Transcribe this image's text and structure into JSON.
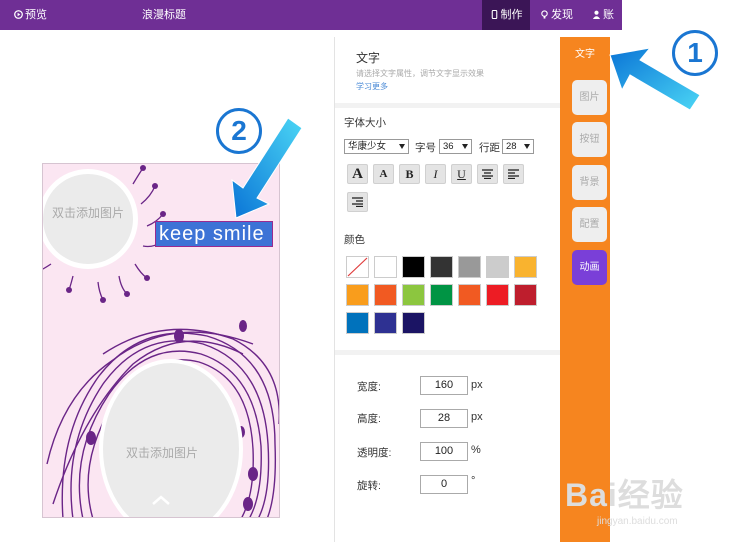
{
  "topbar": {
    "preview": "预览",
    "title": "浪漫标题",
    "make": "制作",
    "discover": "发现",
    "account": "账号"
  },
  "canvas": {
    "placeholder_top": "双击添加图片",
    "placeholder_bottom": "双击添加图片",
    "selected_text": "keep smile"
  },
  "panel": {
    "title": "文字",
    "hint": "请选择文字属性，调节文字显示效果",
    "learn_more": "学习更多",
    "font_size_label": "字体大小",
    "font_family": "华康少女",
    "font_size_prefix": "字号",
    "font_size": "36",
    "line_height_prefix": "行距",
    "line_height": "28",
    "format_buttons": [
      "A",
      "A",
      "B",
      "I",
      "U"
    ],
    "color_label": "颜色",
    "colors": [
      "#ffffff",
      "#ffffff",
      "#000000",
      "#333333",
      "#999999",
      "#cccccc",
      "#f9b32f",
      "#f99d1c",
      "#f15a22",
      "#8cc63f",
      "#009444",
      "#f15a22",
      "#ed1c24",
      "#be1e2d",
      "#0072bc",
      "#2e3192",
      "#1b1464"
    ],
    "width_label": "宽度:",
    "width_value": "160",
    "width_unit": "px",
    "height_label": "高度:",
    "height_value": "28",
    "height_unit": "px",
    "opacity_label": "透明度:",
    "opacity_value": "100",
    "opacity_unit": "%",
    "rotate_label": "旋转:",
    "rotate_value": "0",
    "rotate_unit": "°"
  },
  "tabs": {
    "text": "文字",
    "image": "图片",
    "button": "按钮",
    "background": "背景",
    "config": "配置",
    "animation": "动画"
  },
  "annotations": {
    "one": "1",
    "two": "2",
    "arrow_color": "#1a9ee8"
  },
  "watermark": {
    "line1": "Bai经验",
    "line2": "jingyan.baidu.com"
  }
}
